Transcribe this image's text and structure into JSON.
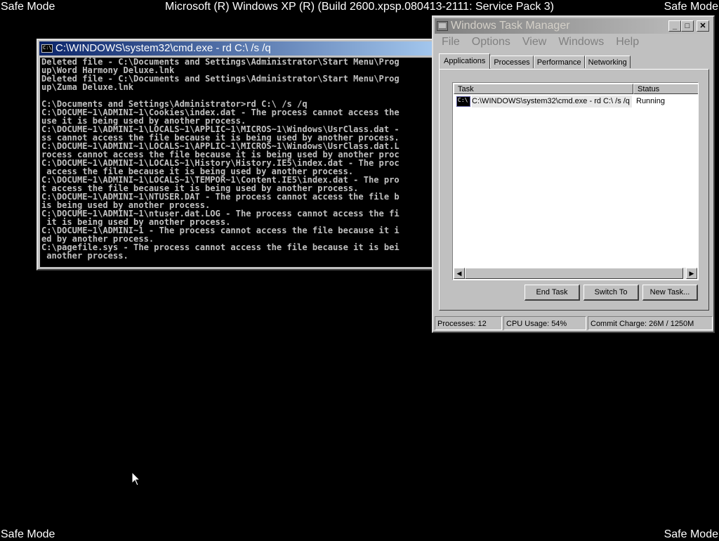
{
  "desktop": {
    "safe_mode_label": "Safe Mode",
    "os_banner": "Microsoft (R) Windows XP (R) (Build 2600.xpsp.080413-2111: Service Pack 3)"
  },
  "cmd_window": {
    "title": "C:\\WINDOWS\\system32\\cmd.exe - rd C:\\ /s /q",
    "lines": [
      "Deleted file - C:\\Documents and Settings\\Administrator\\Start Menu\\Prog",
      "up\\Word Harmony Deluxe.lnk",
      "Deleted file - C:\\Documents and Settings\\Administrator\\Start Menu\\Prog",
      "up\\Zuma Deluxe.lnk",
      "",
      "C:\\Documents and Settings\\Administrator>rd C:\\ /s /q",
      "C:\\DOCUME~1\\ADMINI~1\\Cookies\\index.dat - The process cannot access the",
      "use it is being used by another process.",
      "C:\\DOCUME~1\\ADMINI~1\\LOCALS~1\\APPLIC~1\\MICROS~1\\Windows\\UsrClass.dat -",
      "ss cannot access the file because it is being used by another process.",
      "C:\\DOCUME~1\\ADMINI~1\\LOCALS~1\\APPLIC~1\\MICROS~1\\Windows\\UsrClass.dat.L",
      "rocess cannot access the file because it is being used by another proc",
      "C:\\DOCUME~1\\ADMINI~1\\LOCALS~1\\History\\History.IE5\\index.dat - The proc",
      " access the file because it is being used by another process.",
      "C:\\DOCUME~1\\ADMINI~1\\LOCALS~1\\TEMPOR~1\\Content.IE5\\index.dat - The pro",
      "t access the file because it is being used by another process.",
      "C:\\DOCUME~1\\ADMINI~1\\NTUSER.DAT - The process cannot access the file b",
      "is being used by another process.",
      "C:\\DOCUME~1\\ADMINI~1\\ntuser.dat.LOG - The process cannot access the fi",
      " it is being used by another process.",
      "C:\\DOCUME~1\\ADMINI~1 - The process cannot access the file because it i",
      "ed by another process.",
      "C:\\pagefile.sys - The process cannot access the file because it is bei",
      " another process.",
      "_"
    ]
  },
  "task_manager": {
    "title": "Windows Task Manager",
    "menu": [
      "File",
      "Options",
      "View",
      "Windows",
      "Help"
    ],
    "tabs": [
      "Applications",
      "Processes",
      "Performance",
      "Networking"
    ],
    "columns": {
      "task": "Task",
      "status": "Status"
    },
    "tasks": [
      {
        "name": "C:\\WINDOWS\\system32\\cmd.exe - rd C:\\ /s /q",
        "status": "Running"
      }
    ],
    "buttons": {
      "end_task": "End Task",
      "switch_to": "Switch To",
      "new_task": "New Task..."
    },
    "status_bar": {
      "processes": "Processes: 12",
      "cpu": "CPU Usage: 54%",
      "commit": "Commit Charge: 26M / 1250M"
    }
  }
}
